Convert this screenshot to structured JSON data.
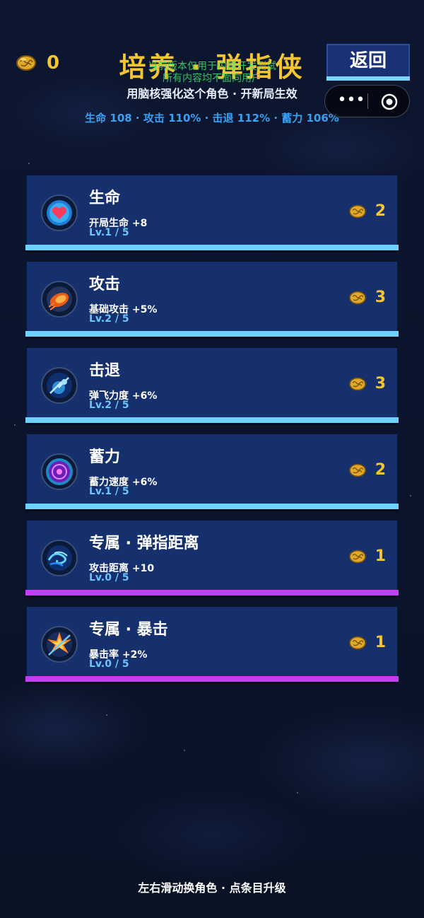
{
  "header": {
    "currency_count": "0",
    "title": "培养 · 弹指侠",
    "watermark_line1": "当前版本仅用于内部开发测试",
    "watermark_line2": "所有内容均不面向用户",
    "subtitle": "用脑核强化这个角色 · 开新局生效",
    "stats": "生命 108 · 攻击 110% · 击退 112% · 蓄力 106%",
    "back_label": "返回"
  },
  "capsule": {
    "menu_glyph": "•••"
  },
  "upgrades": [
    {
      "name": "生命",
      "desc": "开局生命 +8",
      "level": "Lv.1 / 5",
      "cost": "2",
      "bar": "cyan",
      "icon": "heart-orb-icon"
    },
    {
      "name": "攻击",
      "desc": "基础攻击 +5%",
      "level": "Lv.2 / 5",
      "cost": "3",
      "bar": "cyan",
      "icon": "fire-fist-icon"
    },
    {
      "name": "击退",
      "desc": "弹飞力度 +6%",
      "level": "Lv.2 / 5",
      "cost": "3",
      "bar": "cyan",
      "icon": "blue-burst-icon"
    },
    {
      "name": "蓄力",
      "desc": "蓄力速度 +6%",
      "level": "Lv.1 / 5",
      "cost": "2",
      "bar": "cyan",
      "icon": "purple-portal-icon"
    },
    {
      "name": "专属 · 弹指距离",
      "desc": "攻击距离 +10",
      "level": "Lv.0 / 5",
      "cost": "1",
      "bar": "purple",
      "icon": "wind-swirl-icon"
    },
    {
      "name": "专属 · 暴击",
      "desc": "暴击率 +2%",
      "level": "Lv.0 / 5",
      "cost": "1",
      "bar": "purple",
      "icon": "crit-spark-icon"
    }
  ],
  "footer": "左右滑动换角色 · 点条目升级",
  "colors": {
    "gold": "#f3c533",
    "card_bg": "#16306e",
    "cyan_bar": "#6dd2ff",
    "purple_bar": "#c33ef5",
    "stat_blue": "#3aa0f5"
  }
}
